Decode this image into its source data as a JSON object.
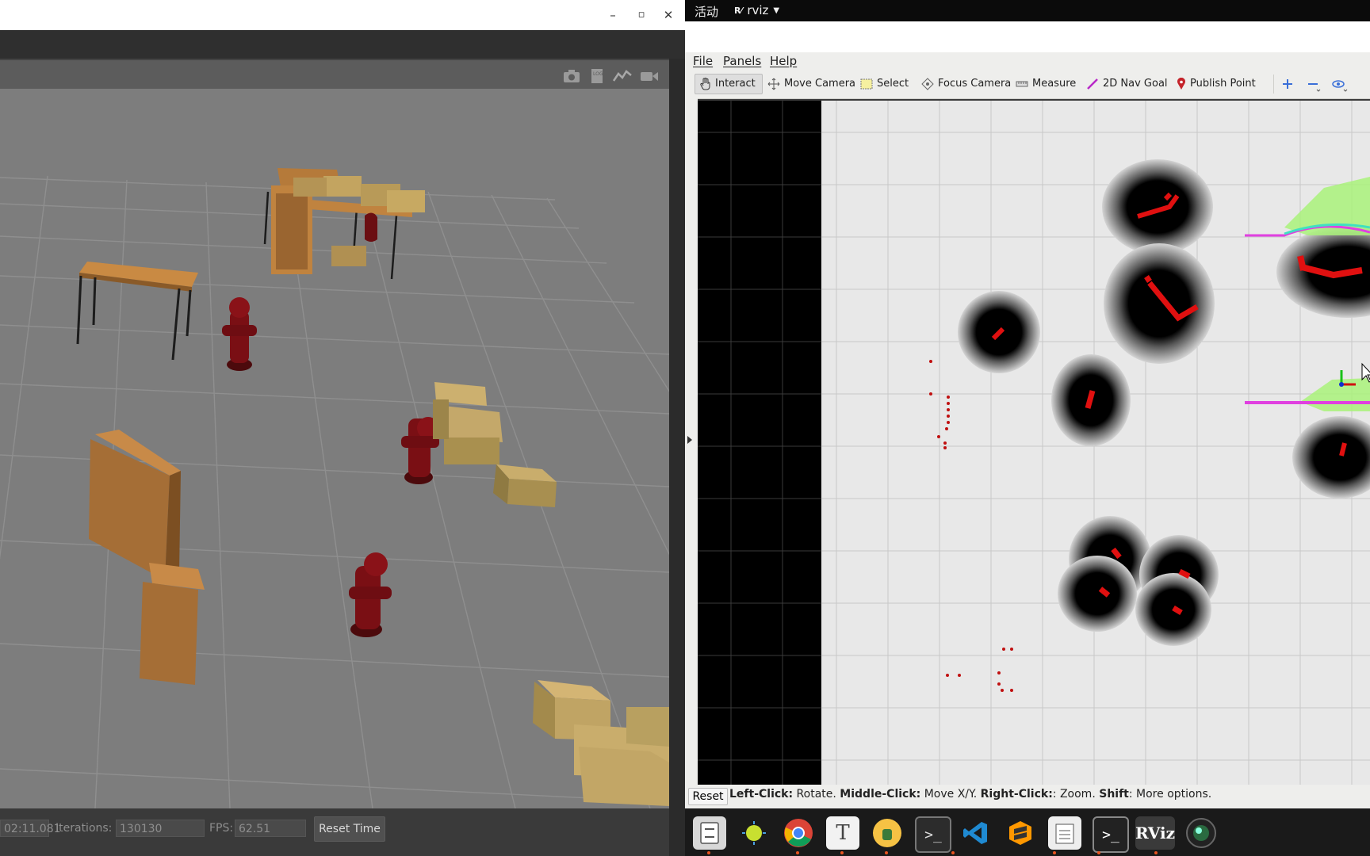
{
  "gazebo": {
    "window_controls": {
      "minimize": "–",
      "maximize": "▫",
      "close": "✕"
    },
    "toolbar_icons": [
      "camera-icon",
      "log-icon",
      "plot-icon",
      "video-icon"
    ],
    "bottom_bar": {
      "sim_time": "02:11.081",
      "iterations_label": "Iterations:",
      "iterations_value": "130130",
      "fps_label": "FPS:",
      "fps_value": "62.51",
      "reset_time_label": "Reset Time"
    }
  },
  "top_panel": {
    "activities": "活动",
    "app_menu": "rviz"
  },
  "rviz": {
    "menus": [
      "File",
      "Panels",
      "Help"
    ],
    "tools": [
      {
        "label": "Interact",
        "icon": "hand-icon",
        "active": true
      },
      {
        "label": "Move Camera",
        "icon": "move-camera-icon"
      },
      {
        "label": "Select",
        "icon": "select-icon"
      },
      {
        "label": "Focus Camera",
        "icon": "focus-camera-icon"
      },
      {
        "label": "Measure",
        "icon": "ruler-icon"
      },
      {
        "label": "2D Nav Goal",
        "icon": "nav-goal-icon"
      },
      {
        "label": "Publish Point",
        "icon": "pin-icon"
      }
    ],
    "status": {
      "reset_label": "Reset",
      "left_click_key": "Left-Click:",
      "left_click_text": "Rotate.",
      "middle_click_key": "Middle-Click:",
      "middle_click_text": "Move X/Y.",
      "right_click_key": "Right-Click:",
      "right_click_text": ": Zoom.",
      "shift_key": "Shift",
      "shift_text": ": More options."
    }
  },
  "dock": {
    "apps": [
      "files-icon",
      "settings-icon",
      "chrome-icon",
      "text-editor-icon",
      "python-icon",
      "terminal-icon",
      "vscode-icon",
      "sublime-icon",
      "notes-icon",
      "terminal2-icon",
      "rviz-icon",
      "camera-lens-icon"
    ],
    "rviz_label": "RViz"
  }
}
